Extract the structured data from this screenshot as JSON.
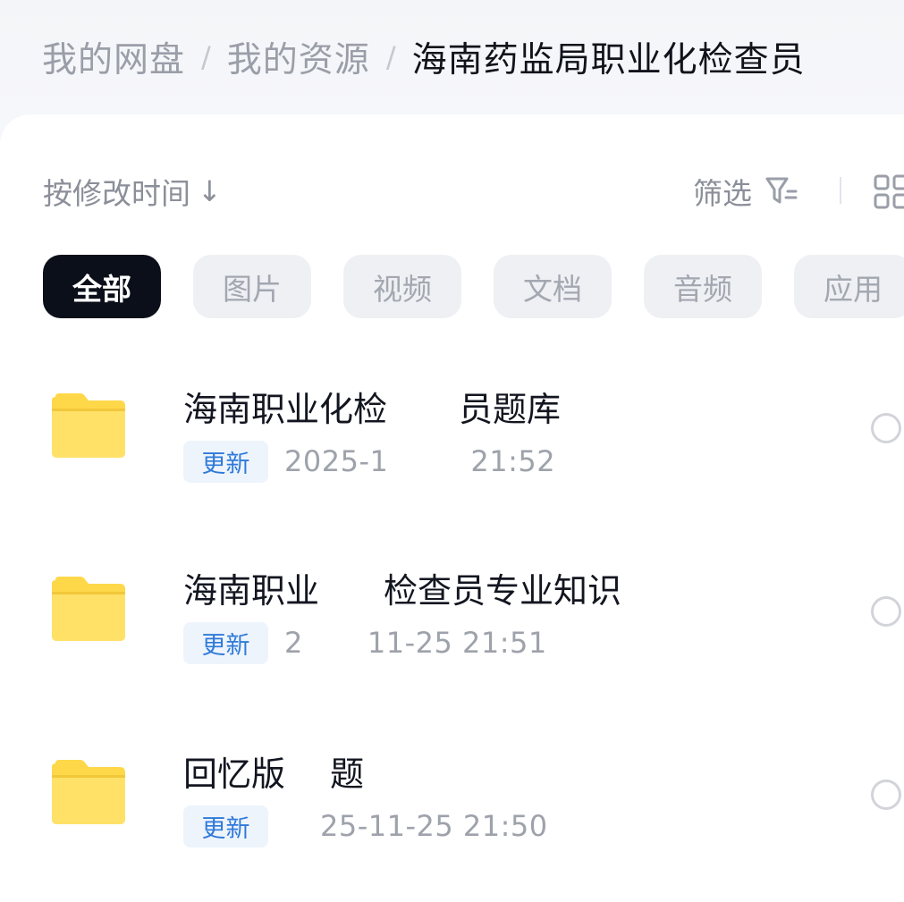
{
  "breadcrumb": {
    "items": [
      "我的网盘",
      "我的资源",
      "海南药监局职业化检查员"
    ],
    "separator": "/"
  },
  "toolbar": {
    "sort_label": "按修改时间",
    "sort_arrow": "↓",
    "filter_label": "筛选",
    "filter_icon": "filter-icon",
    "view_icon": "grid-view-icon"
  },
  "tabs": [
    {
      "label": "全部",
      "active": true
    },
    {
      "label": "图片",
      "active": false
    },
    {
      "label": "视频",
      "active": false
    },
    {
      "label": "文档",
      "active": false
    },
    {
      "label": "音频",
      "active": false
    },
    {
      "label": "应用",
      "active": false
    }
  ],
  "files": [
    {
      "name": "海南职业化检",
      "name_tail": "员题库",
      "badge": "更新",
      "time_head": "2025-1",
      "time_tail": "21:52",
      "icon": "folder-icon"
    },
    {
      "name": "海南职业",
      "name_tail": "检查员专业知识",
      "badge": "更新",
      "time_head": "2",
      "time_tail": "11-25  21:51",
      "icon": "folder-icon"
    },
    {
      "name": "回忆版",
      "name_tail": "题",
      "badge": "更新",
      "time_head": "",
      "time_tail": "25-11-25  21:50",
      "icon": "folder-icon"
    }
  ],
  "colors": {
    "active_tab_bg": "#0b0f19",
    "badge_text": "#2f7ad9",
    "folder": "#ffd84a"
  }
}
